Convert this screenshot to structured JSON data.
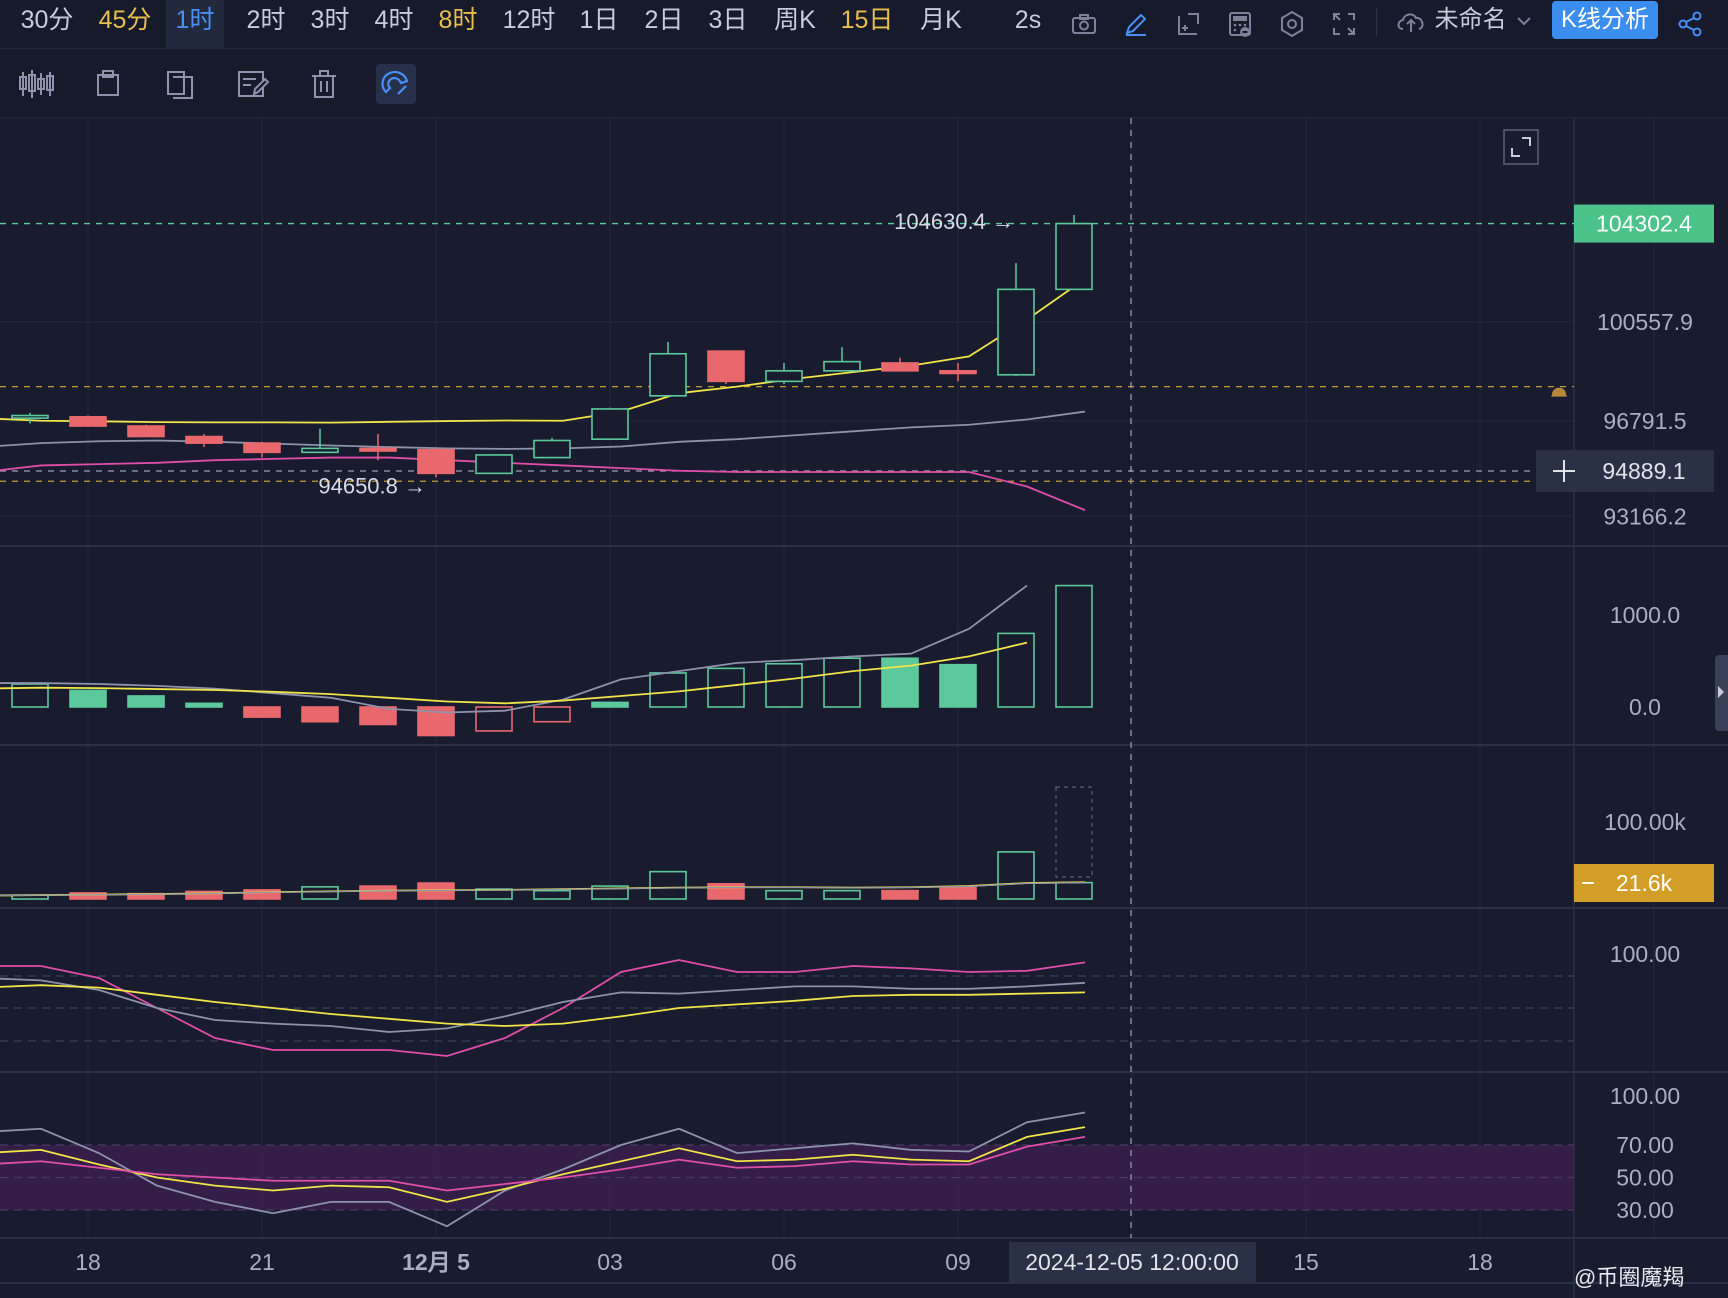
{
  "timeframes": [
    {
      "label": "30分",
      "gold": false,
      "active": false
    },
    {
      "label": "45分",
      "gold": true,
      "active": false
    },
    {
      "label": "1时",
      "gold": false,
      "active": true
    },
    {
      "label": "2时",
      "gold": false,
      "active": false
    },
    {
      "label": "3时",
      "gold": false,
      "active": false
    },
    {
      "label": "4时",
      "gold": false,
      "active": false
    },
    {
      "label": "8时",
      "gold": true,
      "active": false
    },
    {
      "label": "12时",
      "gold": false,
      "active": false
    },
    {
      "label": "1日",
      "gold": false,
      "active": false
    },
    {
      "label": "2日",
      "gold": false,
      "active": false
    },
    {
      "label": "3日",
      "gold": false,
      "active": false
    },
    {
      "label": "周K",
      "gold": false,
      "active": false
    },
    {
      "label": "15日",
      "gold": true,
      "active": false
    },
    {
      "label": "月K",
      "gold": false,
      "active": false
    }
  ],
  "toolbar": {
    "refresh_interval": "2s",
    "icons": [
      "camera-icon",
      "pencil-icon",
      "add-indicator-icon",
      "calculator-icon",
      "settings-icon",
      "fullscreen-icon"
    ],
    "project_name": "未命名",
    "kline_analysis_label": "K线分析"
  },
  "drawing_tools": [
    "candle-style-icon",
    "clipboard-icon",
    "copy-icon",
    "edit-note-icon",
    "trash-icon",
    "magnet-icon"
  ],
  "footer": {
    "watermark": "@币圈魔羯"
  },
  "colors": {
    "up": "#5cc99d",
    "down": "#e9686d",
    "ma_yellow": "#f0e447",
    "ma_gray": "#8d93ab",
    "ma_pink": "#e14ea8",
    "price_tag": "#4cc38a",
    "volume_tag": "#d39e28",
    "band": "#3a1f4b"
  },
  "chart_data": {
    "type": "candlestick",
    "x_ticks": [
      "18",
      "21",
      "12月 5",
      "03",
      "06",
      "09",
      "15",
      "18"
    ],
    "crosshair_time": "2024-12-05 12:00:00",
    "price": {
      "axis_ticks": [
        100557.9,
        96791.5,
        93166.2
      ],
      "last_price": 104302.4,
      "crosshair_price": 94889.1,
      "max_label": "104630.4",
      "min_label": "94650.8",
      "alert_levels": [
        98100,
        94500
      ],
      "candles": [
        {
          "o": 96900,
          "h": 97100,
          "l": 96700,
          "c": 97000
        },
        {
          "o": 96950,
          "h": 97000,
          "l": 96600,
          "c": 96600
        },
        {
          "o": 96600,
          "h": 96650,
          "l": 96200,
          "c": 96200
        },
        {
          "o": 96200,
          "h": 96300,
          "l": 95800,
          "c": 95950
        },
        {
          "o": 95950,
          "h": 96000,
          "l": 95400,
          "c": 95600
        },
        {
          "o": 95600,
          "h": 96500,
          "l": 95600,
          "c": 95750
        },
        {
          "o": 95750,
          "h": 96300,
          "l": 95300,
          "c": 95650
        },
        {
          "o": 95700,
          "h": 95800,
          "l": 94650.8,
          "c": 94800
        },
        {
          "o": 94800,
          "h": 95500,
          "l": 94800,
          "c": 95500
        },
        {
          "o": 95400,
          "h": 96150,
          "l": 95400,
          "c": 96050
        },
        {
          "o": 96100,
          "h": 97300,
          "l": 96100,
          "c": 97250
        },
        {
          "o": 97750,
          "h": 99800,
          "l": 97750,
          "c": 99350
        },
        {
          "o": 99450,
          "h": 99450,
          "l": 98200,
          "c": 98300
        },
        {
          "o": 98300,
          "h": 99000,
          "l": 98200,
          "c": 98700
        },
        {
          "o": 98700,
          "h": 99600,
          "l": 98700,
          "c": 99050
        },
        {
          "o": 99000,
          "h": 99200,
          "l": 98700,
          "c": 98700
        },
        {
          "o": 98700,
          "h": 99000,
          "l": 98300,
          "c": 98600
        },
        {
          "o": 98550,
          "h": 102800,
          "l": 98500,
          "c": 101800
        },
        {
          "o": 101800,
          "h": 104630.4,
          "l": 101800,
          "c": 104302.4
        }
      ],
      "ma_yellow": [
        96900,
        96800,
        96780,
        96750,
        96740,
        96740,
        96730,
        96760,
        96790,
        96810,
        96800,
        97150,
        97850,
        98100,
        98400,
        98650,
        98900,
        99250,
        100650,
        102200
      ],
      "ma_gray": [
        95800,
        95950,
        96020,
        96050,
        96000,
        95930,
        95860,
        95800,
        95750,
        95730,
        95750,
        95820,
        96000,
        96100,
        96250,
        96400,
        96550,
        96650,
        96850,
        97150
      ],
      "ma_pink": [
        94850,
        95100,
        95150,
        95200,
        95300,
        95350,
        95400,
        95400,
        95300,
        95200,
        95100,
        95000,
        94900,
        94850,
        94850,
        94850,
        94850,
        94850,
        94300,
        93400
      ]
    },
    "macd": {
      "axis_ticks": [
        1000.0,
        0.0
      ],
      "histogram": [
        250,
        180,
        120,
        40,
        -110,
        -160,
        -190,
        -310,
        -260,
        -160,
        50,
        370,
        420,
        470,
        530,
        530,
        460,
        800,
        1320
      ],
      "hist_hollow": [
        true,
        false,
        false,
        false,
        false,
        false,
        false,
        false,
        true,
        true,
        false,
        true,
        true,
        true,
        true,
        false,
        false,
        true,
        true
      ],
      "dif": [
        260,
        260,
        250,
        230,
        200,
        150,
        100,
        -20,
        -60,
        -40,
        80,
        300,
        390,
        480,
        510,
        550,
        580,
        850,
        1320
      ],
      "dea": [
        200,
        210,
        205,
        195,
        185,
        165,
        140,
        100,
        60,
        40,
        70,
        120,
        170,
        240,
        310,
        390,
        450,
        550,
        700
      ]
    },
    "volume": {
      "axis_ticks_label": "100.00k",
      "axis_max": 100000,
      "current_label": "21.6k",
      "bars": [
        5000,
        8000,
        7000,
        10000,
        12000,
        16000,
        17000,
        21000,
        13000,
        11000,
        17000,
        36000,
        20000,
        11000,
        11000,
        11000,
        15000,
        62000,
        21600
      ],
      "ma": [
        4500,
        5200,
        5800,
        6500,
        7500,
        9000,
        10000,
        11000,
        11500,
        12000,
        13000,
        14000,
        15000,
        15500,
        15500,
        15000,
        15500,
        17000,
        21000,
        22000
      ]
    },
    "kdj_top": {
      "axis_ticks": [
        100.0
      ],
      "k": [
        80,
        78,
        70,
        55,
        45,
        42,
        40,
        35,
        38,
        48,
        60,
        68,
        67,
        70,
        73,
        73,
        71,
        71,
        73,
        76
      ],
      "d": [
        72,
        74,
        72,
        66,
        60,
        55,
        50,
        46,
        42,
        40,
        42,
        48,
        55,
        58,
        61,
        65,
        66,
        66,
        67,
        68
      ],
      "j": [
        90,
        90,
        80,
        55,
        30,
        20,
        20,
        20,
        15,
        30,
        55,
        85,
        95,
        85,
        85,
        90,
        88,
        85,
        86,
        93
      ]
    },
    "rsi": {
      "axis_ticks": [
        100.0,
        70.0,
        50.0,
        30.0
      ],
      "band": [
        30,
        70
      ],
      "fast": [
        78,
        80,
        65,
        45,
        35,
        28,
        35,
        35,
        20,
        42,
        55,
        70,
        80,
        65,
        68,
        71,
        67,
        66,
        84,
        90
      ],
      "mid": [
        65,
        67,
        58,
        50,
        45,
        42,
        45,
        44,
        35,
        43,
        52,
        60,
        68,
        60,
        61,
        64,
        61,
        60,
        75,
        81
      ],
      "slow": [
        58,
        60,
        56,
        52,
        50,
        48,
        48,
        48,
        42,
        46,
        50,
        55,
        61,
        56,
        57,
        60,
        58,
        58,
        69,
        75
      ]
    }
  }
}
